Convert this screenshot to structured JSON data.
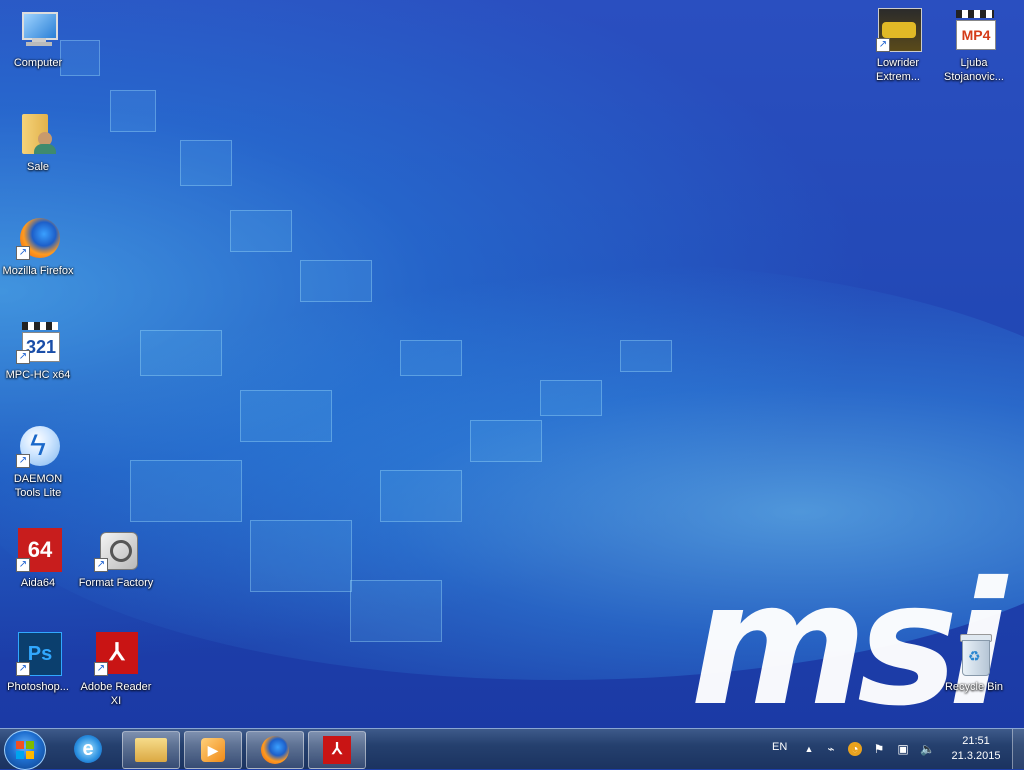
{
  "desktop": {
    "icons_left": [
      {
        "id": "computer",
        "label": "Computer",
        "icon": "computer-icon"
      },
      {
        "id": "sale",
        "label": "Sale",
        "icon": "user-folder-icon"
      },
      {
        "id": "firefox",
        "label": "Mozilla Firefox",
        "icon": "firefox-icon"
      },
      {
        "id": "mpc",
        "label": "MPC-HC x64",
        "icon": "mpc-hc-icon"
      },
      {
        "id": "daemon",
        "label": "DAEMON Tools Lite",
        "icon": "daemon-tools-icon"
      },
      {
        "id": "aida",
        "label": "Aida64",
        "icon": "aida64-icon"
      },
      {
        "id": "format",
        "label": "Format Factory",
        "icon": "format-factory-icon"
      },
      {
        "id": "photoshop",
        "label": "Photoshop...",
        "icon": "photoshop-icon"
      },
      {
        "id": "adobe",
        "label": "Adobe Reader XI",
        "icon": "adobe-reader-icon"
      }
    ],
    "icons_right": [
      {
        "id": "lowrider",
        "label": "Lowrider Extrem...",
        "icon": "lowrider-game-icon"
      },
      {
        "id": "ljuba",
        "label": "Ljuba Stojanovic...",
        "icon": "mp4-file-icon"
      },
      {
        "id": "recycle",
        "label": "Recycle Bin",
        "icon": "recycle-bin-icon"
      }
    ],
    "brand_logo": "msi",
    "colors": {
      "background": "#1d3fa8",
      "accent": "#5ad2ff"
    }
  },
  "taskbar": {
    "start_icon": "windows-start-icon",
    "pinned": [
      {
        "name": "internet-explorer-icon"
      },
      {
        "name": "file-explorer-icon"
      },
      {
        "name": "media-player-icon"
      },
      {
        "name": "firefox-taskbar-icon"
      },
      {
        "name": "adobe-reader-taskbar-icon"
      }
    ],
    "tray": {
      "language": "EN",
      "time": "21:51",
      "date": "21.3.2015"
    }
  }
}
